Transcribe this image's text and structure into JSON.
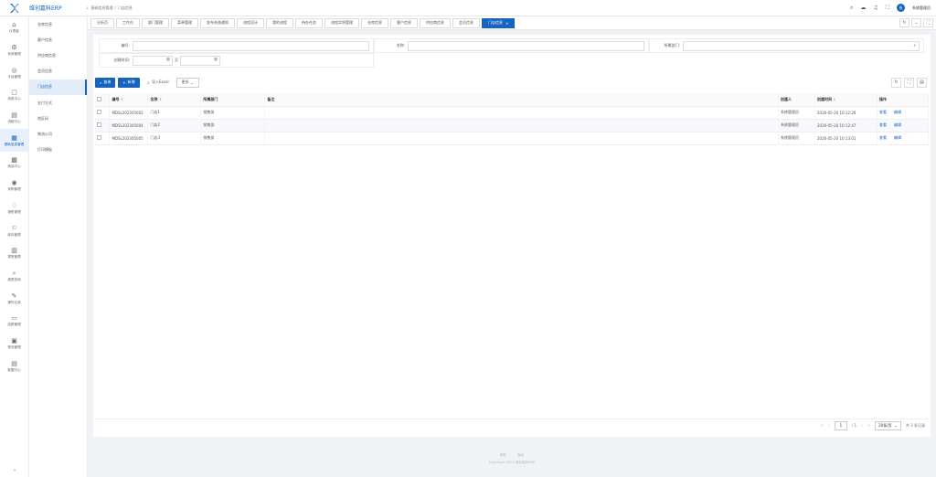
{
  "app": {
    "brand": "维创嘉科ERP",
    "logo_icon": "x-logo-icon",
    "accent": "#1565c0"
  },
  "breadcrumb": [
    "基础信息管理",
    "门店信息"
  ],
  "top_icons": [
    "search-icon",
    "cloud-icon",
    "bell-icon",
    "fullscreen-icon"
  ],
  "user": {
    "avatar_text": "系",
    "name": "系统管理员"
  },
  "rail": [
    {
      "label": "仪表板",
      "glyph": "⌂",
      "name": "dashboard"
    },
    {
      "label": "系统管理",
      "glyph": "⚙",
      "name": "system"
    },
    {
      "label": "平台管理",
      "glyph": "◎",
      "name": "platform"
    },
    {
      "label": "消息中心",
      "glyph": "▢",
      "name": "messages"
    },
    {
      "label": "流程中心",
      "glyph": "▤",
      "name": "workflow"
    },
    {
      "label": "基础信息管理",
      "glyph": "▦",
      "name": "basic-info",
      "active": true
    },
    {
      "label": "商品中心",
      "glyph": "▩",
      "name": "goods"
    },
    {
      "label": "采购管理",
      "glyph": "◉",
      "name": "purchase"
    },
    {
      "label": "销售管理",
      "glyph": "♢",
      "name": "sales"
    },
    {
      "label": "库存管理",
      "glyph": "⚐",
      "name": "inventory"
    },
    {
      "label": "零售管理",
      "glyph": "▥",
      "name": "retail"
    },
    {
      "label": "报表查询",
      "glyph": "⌕",
      "name": "reports"
    },
    {
      "label": "操作记录",
      "glyph": "✎",
      "name": "logs"
    },
    {
      "label": "结算管理",
      "glyph": "▭",
      "name": "settlement"
    },
    {
      "label": "物流管理",
      "glyph": "▣",
      "name": "logistics"
    },
    {
      "label": "数据中心",
      "glyph": "▤",
      "name": "data"
    }
  ],
  "rail_collapse": "«",
  "submenu": [
    {
      "label": "仓库信息"
    },
    {
      "label": "客户信息"
    },
    {
      "label": "供应商信息"
    },
    {
      "label": "会员信息"
    },
    {
      "label": "门店信息",
      "active": true
    },
    {
      "label": "支付方式"
    },
    {
      "label": "地区码"
    },
    {
      "label": "物流公司"
    },
    {
      "label": "打印模板"
    }
  ],
  "tabs": [
    {
      "label": "分析页"
    },
    {
      "label": "工作台"
    },
    {
      "label": "部门管理"
    },
    {
      "label": "菜单管理"
    },
    {
      "label": "发布系统通知"
    },
    {
      "label": "流程设计"
    },
    {
      "label": "我的流程"
    },
    {
      "label": "待办任务"
    },
    {
      "label": "流程实例管理"
    },
    {
      "label": "仓库信息"
    },
    {
      "label": "客户信息"
    },
    {
      "label": "供应商信息"
    },
    {
      "label": "会员信息"
    },
    {
      "label": "门店信息",
      "active": true,
      "close": "×"
    }
  ],
  "tab_controls": [
    "↻",
    "⌄",
    "⛶"
  ],
  "filters": {
    "code_label": "编号:",
    "name_label": "名称:",
    "dept_label": "所属部门:",
    "created_label": "创建时间:",
    "date_sep": "至",
    "code_value": "",
    "name_value": "",
    "dept_value": ""
  },
  "toolbar": {
    "search": "查询",
    "add": "新增",
    "import": "导入Excel",
    "more": "更多",
    "right_icons": [
      "refresh-icon",
      "fullscreen-icon",
      "columns-icon"
    ]
  },
  "table": {
    "columns": [
      "编号",
      "名称",
      "所属部门",
      "备注",
      "创建人",
      "创建时间",
      "操作"
    ],
    "rows": [
      {
        "code": "MDSL202305002",
        "name": "门店1",
        "dept": "销售部",
        "note": "",
        "creator": "系统管理员",
        "time": "2026-05-20 10:12:28",
        "ops": [
          "查看",
          "编辑"
        ]
      },
      {
        "code": "MDSL202305004",
        "name": "门店2",
        "dept": "销售部",
        "note": "",
        "creator": "系统管理员",
        "time": "2026-05-20 10:12:47",
        "ops": [
          "查看",
          "编辑"
        ]
      },
      {
        "code": "MDSL202305005",
        "name": "门店3",
        "dept": "销售部",
        "note": "",
        "creator": "系统管理员",
        "time": "2026-05-20 10:13:01",
        "ops": [
          "查看",
          "编辑"
        ]
      }
    ]
  },
  "pager": {
    "page": "1",
    "total_pages": "/ 1",
    "page_size": "20条/页",
    "total": "共 3 条记录"
  },
  "footer": {
    "links": [
      "帮助",
      "隐私"
    ],
    "copyright": "Copyright 2023 维创嘉科ERP"
  }
}
